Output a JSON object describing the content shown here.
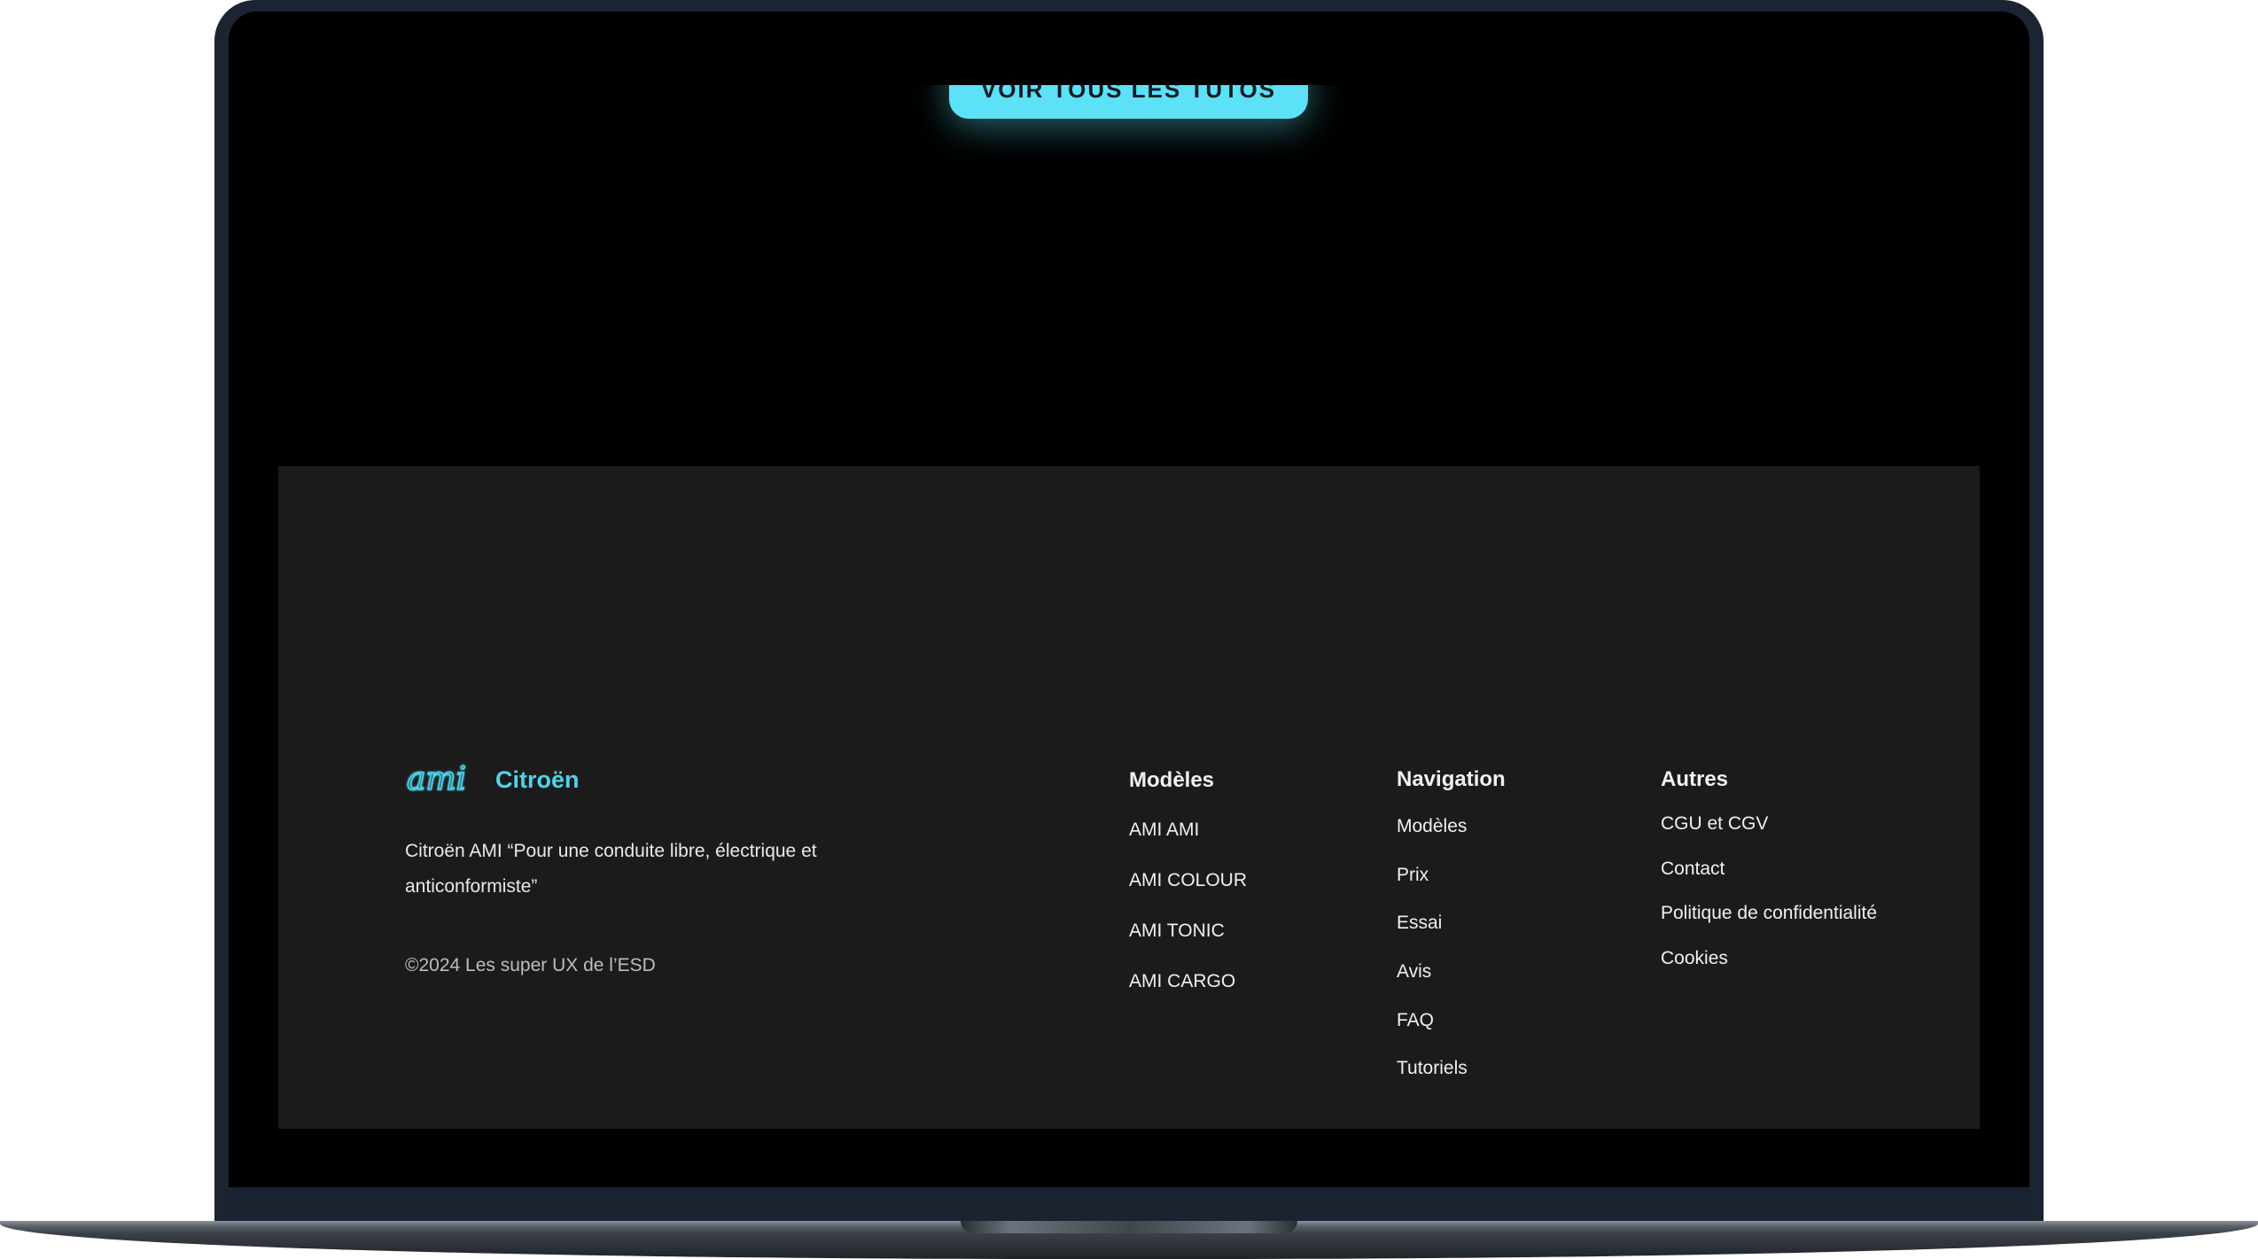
{
  "hero": {
    "cta_label": "VOIR TOUS LES TUTOS"
  },
  "footer": {
    "brand": {
      "logo_icon": "ami-script-logo-icon",
      "logo_text": "ami",
      "name": "Citroën"
    },
    "tagline": "Citroën AMI “Pour une conduite libre, électrique et anticonformiste”",
    "copyright": "©2024 Les super UX de l’ESD",
    "columns": {
      "models": {
        "title": "Modèles",
        "items": [
          "AMI AMI",
          "AMI COLOUR",
          "AMI TONIC",
          "AMI CARGO"
        ]
      },
      "navigation": {
        "title": "Navigation",
        "items": [
          "Modèles",
          "Prix",
          "Essai",
          "Avis",
          "FAQ",
          "Tutoriels"
        ]
      },
      "other": {
        "title": "Autres",
        "items": [
          "CGU et CGV",
          "Contact",
          "Politique de confidentialité",
          "Cookies"
        ]
      }
    }
  },
  "colors": {
    "accent": "#5ce1f7",
    "brand": "#4fd3ec",
    "footer_bg": "#1b1b1b",
    "page_bg": "#000000",
    "laptop_frame": "#1c2432"
  }
}
